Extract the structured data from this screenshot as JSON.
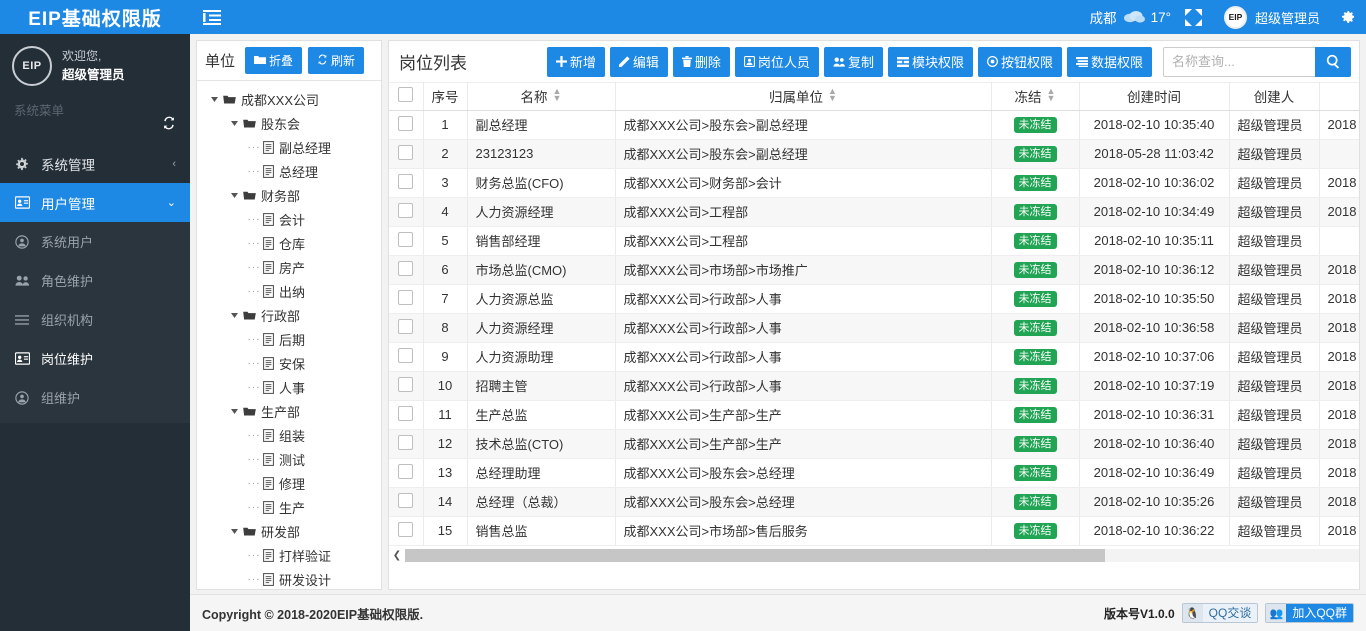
{
  "topbar": {
    "brand": "EIP基础权限版",
    "menu_toggle_icon": "hamburger-icon",
    "weather_city": "成都",
    "weather_icon": "cloud-icon",
    "weather_temp": "17°",
    "fullscreen_icon": "fullscreen-icon",
    "avatar_text": "EIP",
    "user_name": "超级管理员",
    "settings_icon": "gear-icon"
  },
  "sidebar": {
    "avatar_text": "EIP",
    "welcome": "欢迎您,",
    "user_name": "超级管理员",
    "menu_label": "系统菜单",
    "refresh_icon": "refresh-icon",
    "items": [
      {
        "label": "系统管理",
        "icon": "gear-icon",
        "caret": "‹",
        "active": false
      },
      {
        "label": "用户管理",
        "icon": "id-card-icon",
        "caret": "⌄",
        "active": true
      }
    ],
    "sub_items": [
      {
        "label": "系统用户",
        "icon": "user-circle-icon",
        "current": false
      },
      {
        "label": "角色维护",
        "icon": "users-icon",
        "current": false
      },
      {
        "label": "组织机构",
        "icon": "list-icon",
        "current": false
      },
      {
        "label": "岗位维护",
        "icon": "id-card-icon",
        "current": true
      },
      {
        "label": "组维护",
        "icon": "user-circle-icon",
        "current": false
      }
    ]
  },
  "tree_panel": {
    "title": "单位",
    "collapse_label": "折叠",
    "collapse_icon": "folder-icon",
    "refresh_label": "刷新",
    "refresh_icon": "refresh-icon",
    "nodes": [
      {
        "label": "成都XXX公司",
        "depth": 0,
        "type": "folder"
      },
      {
        "label": "股东会",
        "depth": 1,
        "type": "folder"
      },
      {
        "label": "副总经理",
        "depth": 2,
        "type": "file"
      },
      {
        "label": "总经理",
        "depth": 2,
        "type": "file"
      },
      {
        "label": "财务部",
        "depth": 1,
        "type": "folder"
      },
      {
        "label": "会计",
        "depth": 2,
        "type": "file"
      },
      {
        "label": "仓库",
        "depth": 2,
        "type": "file"
      },
      {
        "label": "房产",
        "depth": 2,
        "type": "file"
      },
      {
        "label": "出纳",
        "depth": 2,
        "type": "file"
      },
      {
        "label": "行政部",
        "depth": 1,
        "type": "folder"
      },
      {
        "label": "后期",
        "depth": 2,
        "type": "file"
      },
      {
        "label": "安保",
        "depth": 2,
        "type": "file"
      },
      {
        "label": "人事",
        "depth": 2,
        "type": "file"
      },
      {
        "label": "生产部",
        "depth": 1,
        "type": "folder"
      },
      {
        "label": "组装",
        "depth": 2,
        "type": "file"
      },
      {
        "label": "测试",
        "depth": 2,
        "type": "file"
      },
      {
        "label": "修理",
        "depth": 2,
        "type": "file"
      },
      {
        "label": "生产",
        "depth": 2,
        "type": "file"
      },
      {
        "label": "研发部",
        "depth": 1,
        "type": "folder"
      },
      {
        "label": "打样验证",
        "depth": 2,
        "type": "file"
      },
      {
        "label": "研发设计",
        "depth": 2,
        "type": "file"
      }
    ]
  },
  "list_panel": {
    "title": "岗位列表",
    "toolbar": [
      {
        "label": "新增",
        "icon": "plus-icon"
      },
      {
        "label": "编辑",
        "icon": "pencil-icon"
      },
      {
        "label": "删除",
        "icon": "trash-icon"
      },
      {
        "label": "岗位人员",
        "icon": "user-box-icon"
      },
      {
        "label": "复制",
        "icon": "copy-icon"
      },
      {
        "label": "模块权限",
        "icon": "grid-icon"
      },
      {
        "label": "按钮权限",
        "icon": "circle-dot-icon"
      },
      {
        "label": "数据权限",
        "icon": "layers-icon"
      }
    ],
    "search_placeholder": "名称查询...",
    "search_value": "",
    "search_icon": "search-icon",
    "columns": [
      {
        "key": "checkbox",
        "label": "",
        "sortable": false
      },
      {
        "key": "no",
        "label": "序号",
        "sortable": false
      },
      {
        "key": "name",
        "label": "名称",
        "sortable": true
      },
      {
        "key": "unit",
        "label": "归属单位",
        "sortable": true
      },
      {
        "key": "frozen",
        "label": "冻结",
        "sortable": true
      },
      {
        "key": "created_at",
        "label": "创建时间",
        "sortable": false
      },
      {
        "key": "created_by",
        "label": "创建人",
        "sortable": false
      },
      {
        "key": "modified_at",
        "label": "",
        "sortable": false
      }
    ],
    "rows": [
      {
        "no": "1",
        "name": "副总经理",
        "unit": "成都XXX公司>股东会>副总经理",
        "frozen": "未冻结",
        "created_at": "2018-02-10 10:35:40",
        "created_by": "超级管理员",
        "modified_at": "2018"
      },
      {
        "no": "2",
        "name": "23123123",
        "unit": "成都XXX公司>股东会>副总经理",
        "frozen": "未冻结",
        "created_at": "2018-05-28 11:03:42",
        "created_by": "超级管理员",
        "modified_at": ""
      },
      {
        "no": "3",
        "name": "财务总监(CFO)",
        "unit": "成都XXX公司>财务部>会计",
        "frozen": "未冻结",
        "created_at": "2018-02-10 10:36:02",
        "created_by": "超级管理员",
        "modified_at": "2018"
      },
      {
        "no": "4",
        "name": "人力资源经理",
        "unit": "成都XXX公司>工程部",
        "frozen": "未冻结",
        "created_at": "2018-02-10 10:34:49",
        "created_by": "超级管理员",
        "modified_at": "2018"
      },
      {
        "no": "5",
        "name": "销售部经理",
        "unit": "成都XXX公司>工程部",
        "frozen": "未冻结",
        "created_at": "2018-02-10 10:35:11",
        "created_by": "超级管理员",
        "modified_at": ""
      },
      {
        "no": "6",
        "name": "市场总监(CMO)",
        "unit": "成都XXX公司>市场部>市场推广",
        "frozen": "未冻结",
        "created_at": "2018-02-10 10:36:12",
        "created_by": "超级管理员",
        "modified_at": "2018"
      },
      {
        "no": "7",
        "name": "人力资源总监",
        "unit": "成都XXX公司>行政部>人事",
        "frozen": "未冻结",
        "created_at": "2018-02-10 10:35:50",
        "created_by": "超级管理员",
        "modified_at": "2018"
      },
      {
        "no": "8",
        "name": "人力资源经理",
        "unit": "成都XXX公司>行政部>人事",
        "frozen": "未冻结",
        "created_at": "2018-02-10 10:36:58",
        "created_by": "超级管理员",
        "modified_at": "2018"
      },
      {
        "no": "9",
        "name": "人力资源助理",
        "unit": "成都XXX公司>行政部>人事",
        "frozen": "未冻结",
        "created_at": "2018-02-10 10:37:06",
        "created_by": "超级管理员",
        "modified_at": "2018"
      },
      {
        "no": "10",
        "name": "招聘主管",
        "unit": "成都XXX公司>行政部>人事",
        "frozen": "未冻结",
        "created_at": "2018-02-10 10:37:19",
        "created_by": "超级管理员",
        "modified_at": "2018"
      },
      {
        "no": "11",
        "name": "生产总监",
        "unit": "成都XXX公司>生产部>生产",
        "frozen": "未冻结",
        "created_at": "2018-02-10 10:36:31",
        "created_by": "超级管理员",
        "modified_at": "2018"
      },
      {
        "no": "12",
        "name": "技术总监(CTO)",
        "unit": "成都XXX公司>生产部>生产",
        "frozen": "未冻结",
        "created_at": "2018-02-10 10:36:40",
        "created_by": "超级管理员",
        "modified_at": "2018"
      },
      {
        "no": "13",
        "name": "总经理助理",
        "unit": "成都XXX公司>股东会>总经理",
        "frozen": "未冻结",
        "created_at": "2018-02-10 10:36:49",
        "created_by": "超级管理员",
        "modified_at": "2018"
      },
      {
        "no": "14",
        "name": "总经理（总裁）",
        "unit": "成都XXX公司>股东会>总经理",
        "frozen": "未冻结",
        "created_at": "2018-02-10 10:35:26",
        "created_by": "超级管理员",
        "modified_at": "2018"
      },
      {
        "no": "15",
        "name": "销售总监",
        "unit": "成都XXX公司>市场部>售后服务",
        "frozen": "未冻结",
        "created_at": "2018-02-10 10:36:22",
        "created_by": "超级管理员",
        "modified_at": "2018"
      }
    ]
  },
  "footer": {
    "copyright": "Copyright © 2018-2020EIP基础权限版.",
    "version": "版本号V1.0.0",
    "qq_chat": "QQ交谈",
    "qq_group": "加入QQ群"
  },
  "colors": {
    "primary": "#1e88e5",
    "sidebar_bg": "#242e37",
    "sidebar_sub_bg": "#2b353e",
    "badge_green": "#21a453"
  }
}
